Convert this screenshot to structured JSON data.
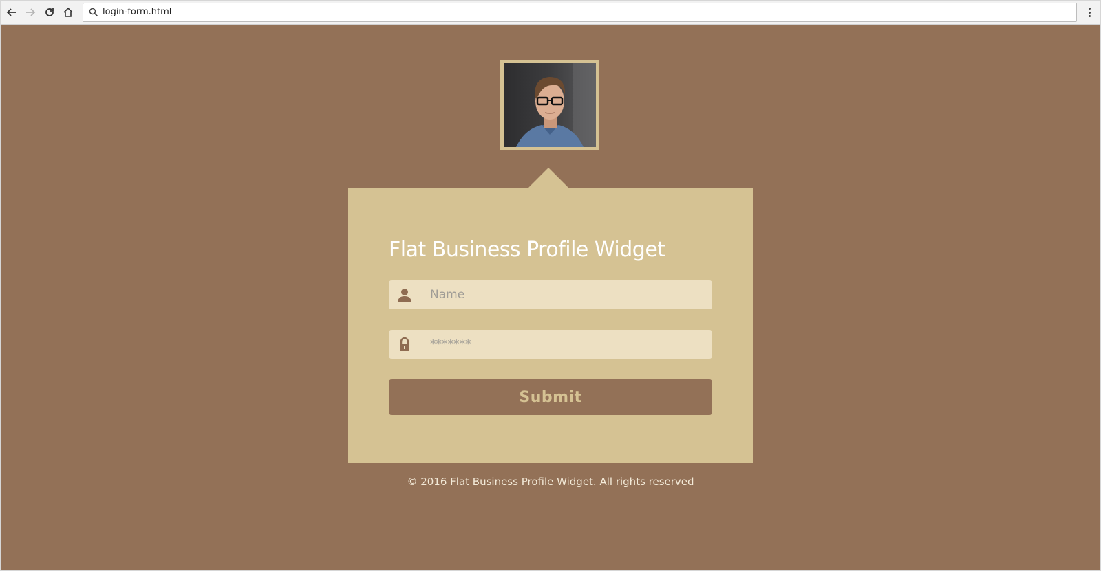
{
  "browser": {
    "url": "login-form.html",
    "icons": [
      "back-arrow-icon",
      "forward-arrow-icon",
      "reload-icon",
      "home-icon",
      "search-icon",
      "kebab-menu-icon"
    ]
  },
  "page": {
    "background_color": "#937157",
    "card_color": "#d5c293",
    "field_color": "#ede0c2"
  },
  "widget": {
    "title": "Flat Business Profile Widget",
    "name_placeholder": "Name",
    "password_placeholder": "*******",
    "submit_label": "Submit"
  },
  "footer": {
    "text": "© 2016 Flat Business Profile Widget. All rights reserved"
  }
}
